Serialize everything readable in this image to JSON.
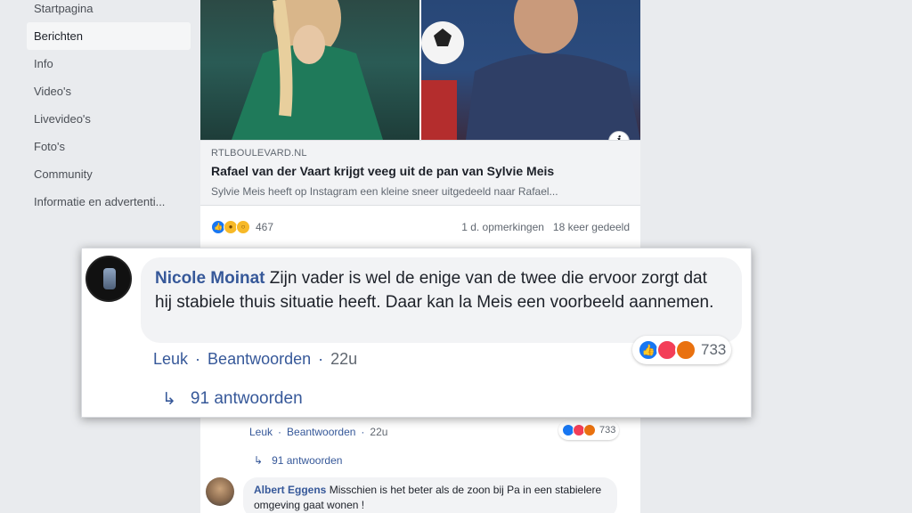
{
  "nav": {
    "items": [
      {
        "label": "Startpagina",
        "active": false
      },
      {
        "label": "Berichten",
        "active": true
      },
      {
        "label": "Info",
        "active": false
      },
      {
        "label": "Video's",
        "active": false
      },
      {
        "label": "Livevideo's",
        "active": false
      },
      {
        "label": "Foto's",
        "active": false
      },
      {
        "label": "Community",
        "active": false
      },
      {
        "label": "Informatie en advertenti...",
        "active": false
      }
    ]
  },
  "post": {
    "link": {
      "domain": "RTLBOULEVARD.NL",
      "title": "Rafael van der Vaart krijgt veeg uit de pan van Sylvie Meis",
      "description": "Sylvie Meis heeft op Instagram een kleine sneer uitgedeeld naar Rafael..."
    },
    "stats": {
      "reaction_icons": [
        "like-icon",
        "haha-icon",
        "wow-icon"
      ],
      "reaction_count": "467",
      "comments": "1 d. opmerkingen",
      "shares": "18 keer gedeeld"
    }
  },
  "highlighted_comment": {
    "author": "Nicole Moinat",
    "text": "Zijn vader is wel de enige van de twee die ervoor zorgt dat hij stabiele thuis situatie heeft. Daar kan la Meis een voorbeeld aannemen.",
    "reaction_icons": [
      "like-icon",
      "love-icon",
      "angry-icon"
    ],
    "reaction_count": "733",
    "actions": {
      "like": "Leuk",
      "reply": "Beantwoorden",
      "time": "22u"
    },
    "replies": "91 antwoorden"
  },
  "background_comment": {
    "actions": {
      "like": "Leuk",
      "reply": "Beantwoorden",
      "time": "22u"
    },
    "reaction_count": "733",
    "replies": "91 antwoorden"
  },
  "second_comment": {
    "author": "Albert Eggens",
    "text": "Misschien is het beter als de zoon bij Pa in een stabielere omgeving gaat wonen !"
  },
  "colors": {
    "link_blue": "#365899",
    "like_blue": "#1877f2",
    "love_red": "#f33e58",
    "angry_orange": "#e9710f",
    "page_bg": "#e9ebee"
  }
}
